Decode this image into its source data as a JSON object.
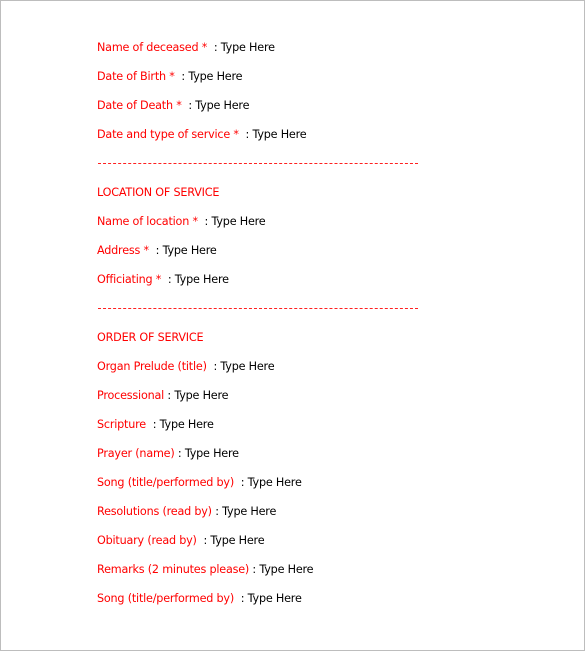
{
  "document": {
    "separator": " : ",
    "placeholder": "Type Here",
    "colors": {
      "label": "#ff0000",
      "value": "#000000",
      "border": "#bdbdbd"
    },
    "sections": [
      {
        "heading": "",
        "fields": [
          {
            "label": "Name of deceased * ",
            "value": "Type Here"
          },
          {
            "label": "Date of Birth * ",
            "value": "Type Here"
          },
          {
            "label": "Date of Death * ",
            "value": "Type Here"
          },
          {
            "label": "Date and type of service * ",
            "value": "Type Here"
          }
        ]
      },
      {
        "heading": "LOCATION OF SERVICE",
        "fields": [
          {
            "label": "Name of location * ",
            "value": "Type Here"
          },
          {
            "label": "Address * ",
            "value": "Type Here"
          },
          {
            "label": "Officiating * ",
            "value": "Type Here"
          }
        ]
      },
      {
        "heading": "ORDER OF SERVICE",
        "fields": [
          {
            "label": "Organ Prelude (title) ",
            "value": "Type Here"
          },
          {
            "label": "Processional",
            "value": "Type Here"
          },
          {
            "label": "Scripture ",
            "value": "Type Here"
          },
          {
            "label": "Prayer (name)",
            "value": "Type Here"
          },
          {
            "label": "Song (title/performed by) ",
            "value": "Type Here"
          },
          {
            "label": "Resolutions (read by)",
            "value": "Type Here"
          },
          {
            "label": "Obituary (read by) ",
            "value": "Type Here"
          },
          {
            "label": "Remarks (2 minutes please)",
            "value": "Type Here"
          },
          {
            "label": "Song (title/performed by) ",
            "value": "Type Here"
          }
        ]
      }
    ]
  }
}
